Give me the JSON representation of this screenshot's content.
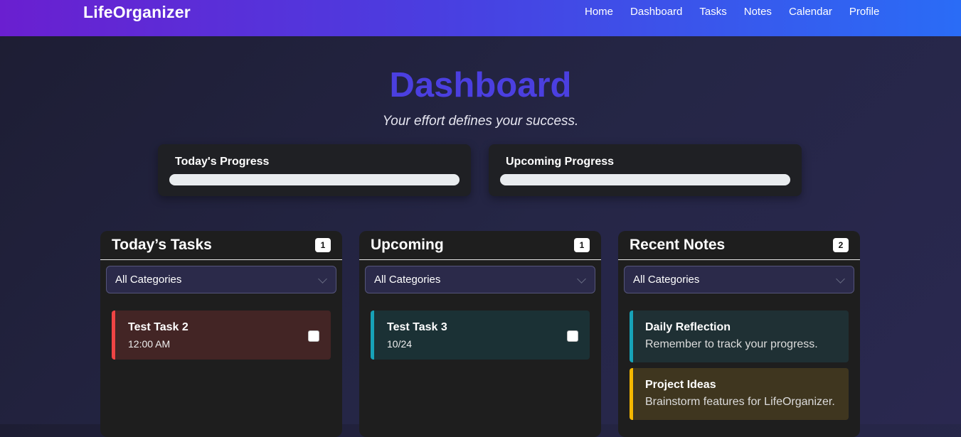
{
  "navbar": {
    "brand": "LifeOrganizer",
    "links": [
      "Home",
      "Dashboard",
      "Tasks",
      "Notes",
      "Calendar",
      "Profile"
    ]
  },
  "header": {
    "title": "Dashboard",
    "tagline": "Your effort defines your success."
  },
  "progress": {
    "today": {
      "label": "Today's Progress",
      "value": 0
    },
    "upcoming": {
      "label": "Upcoming Progress",
      "value": 0
    }
  },
  "columns": {
    "today": {
      "title": "Today’s Tasks",
      "count": "1",
      "filter": "All Categories",
      "tasks": [
        {
          "title": "Test Task 2",
          "sub": "12:00 AM",
          "accent": "#ef4444",
          "bg": "#432525"
        }
      ]
    },
    "upcoming": {
      "title": "Upcoming",
      "count": "1",
      "filter": "All Categories",
      "tasks": [
        {
          "title": "Test Task 3",
          "sub": "10/24",
          "accent": "#17a2b8",
          "bg": "#1b3135"
        }
      ]
    },
    "notes": {
      "title": "Recent Notes",
      "count": "2",
      "filter": "All Categories",
      "items": [
        {
          "title": "Daily Reflection",
          "body": "Remember to track your progress.",
          "accent": "#17a2b8",
          "bg": "#1f3034"
        },
        {
          "title": "Project Ideas",
          "body": "Brainstorm features for LifeOrganizer.",
          "accent": "#f5b800",
          "bg": "#3f361f"
        }
      ]
    }
  }
}
